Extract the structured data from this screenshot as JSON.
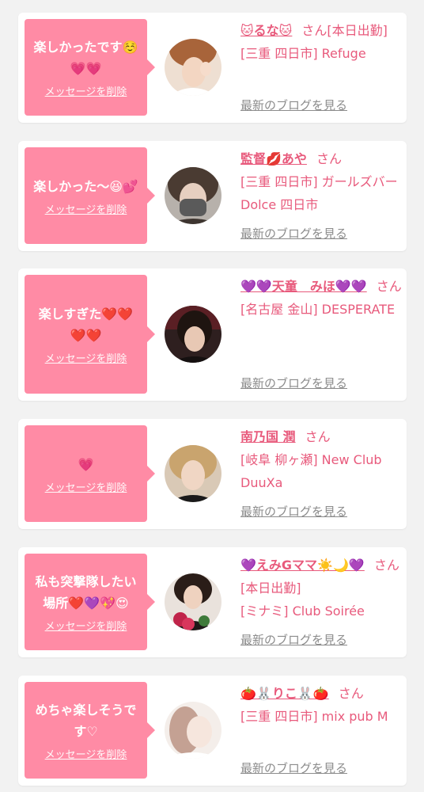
{
  "colors": {
    "background": "#f2f2f2",
    "bubble": "#ff8ba5",
    "accent_text": "#e85a7c",
    "link_gray": "#8c8c8c"
  },
  "delete_label": "メッセージを削除",
  "blog_label": "最新のブログを見る",
  "honorific": "さん",
  "items": [
    {
      "message": "楽しかったです☺️💗💗",
      "name": "🐱るな🐱",
      "status": "[本日出勤]",
      "shop": "[三重 四日市] Refuge"
    },
    {
      "message": "楽しかった〜😆💕",
      "name": "監督💋あや",
      "status": "",
      "shop": "[三重 四日市] ガールズバー Dolce 四日市"
    },
    {
      "message": "楽しすぎた❤️❤️❤️❤️",
      "name": "💜💜天童　みほ💜💜",
      "status": "",
      "shop": "[名古屋 金山] DESPERATE"
    },
    {
      "message": "💗",
      "name": "南乃国 潤",
      "status": "",
      "shop": "[岐阜 柳ヶ瀬] New Club DuuXa"
    },
    {
      "message": "私も突撃隊したい場所❤️💜💖😍",
      "name": "💜えみGママ☀️🌙💜",
      "status": "[本日出勤]",
      "shop": "[ミナミ] Club Soirée"
    },
    {
      "message": "めちゃ楽しそうです♡",
      "name": "🍅🐰りこ🐰🍅",
      "status": "",
      "shop": "[三重 四日市] mix pub M"
    }
  ]
}
